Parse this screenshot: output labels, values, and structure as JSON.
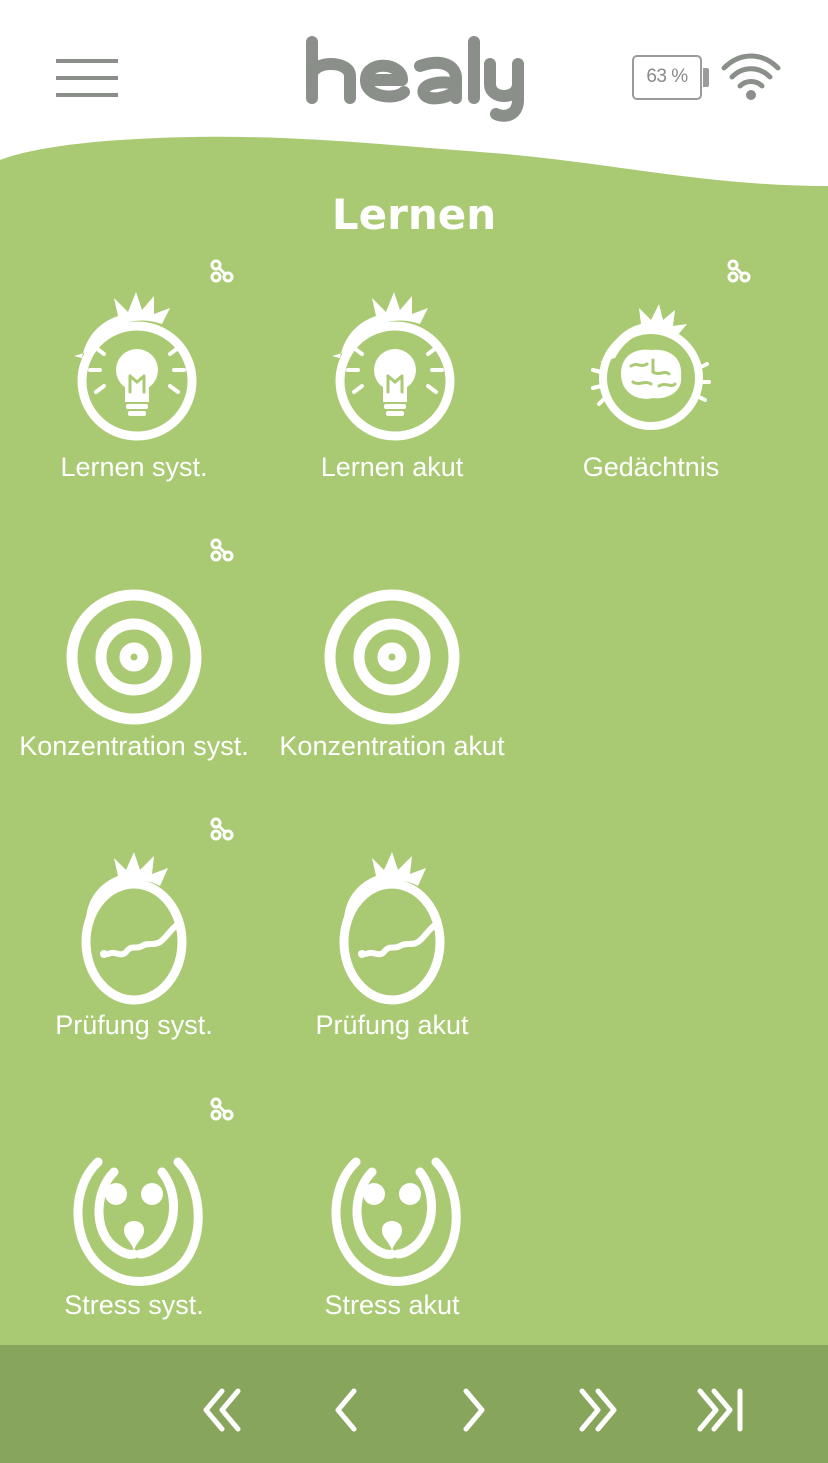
{
  "header": {
    "logo_text": "healy",
    "battery_percent": "63 %",
    "icons": [
      "menu-icon",
      "battery-icon",
      "wifi-icon"
    ]
  },
  "page": {
    "title": "Lernen"
  },
  "programs": [
    {
      "label": "Lernen syst.",
      "icon": "lightbulb-head-icon",
      "badge": true
    },
    {
      "label": "Lernen akut",
      "icon": "lightbulb-head-icon",
      "badge": false
    },
    {
      "label": "Gedächtnis",
      "icon": "brain-head-icon",
      "badge": true
    },
    {
      "label": "Konzentration syst.",
      "icon": "target-icon",
      "badge": true
    },
    {
      "label": "Konzentration akut",
      "icon": "target-icon",
      "badge": false
    },
    {
      "label": "Prüfung syst.",
      "icon": "worried-head-icon",
      "badge": true
    },
    {
      "label": "Prüfung akut",
      "icon": "worried-head-icon",
      "badge": false
    },
    {
      "label": "Stress syst.",
      "icon": "stress-icon",
      "badge": true
    },
    {
      "label": "Stress akut",
      "icon": "stress-icon",
      "badge": false
    }
  ],
  "footer": {
    "nav": [
      {
        "symbol": "«",
        "name": "first-page-button"
      },
      {
        "symbol": "‹",
        "name": "previous-page-button"
      },
      {
        "symbol": "›",
        "name": "next-page-button"
      },
      {
        "symbol": "»",
        "name": "fast-forward-button"
      },
      {
        "symbol": "»|",
        "name": "last-page-button"
      }
    ]
  },
  "colors": {
    "background": "#a9ca72",
    "footer": "#88a55c",
    "header": "#ffffff",
    "logo": "#8a8f8a"
  }
}
